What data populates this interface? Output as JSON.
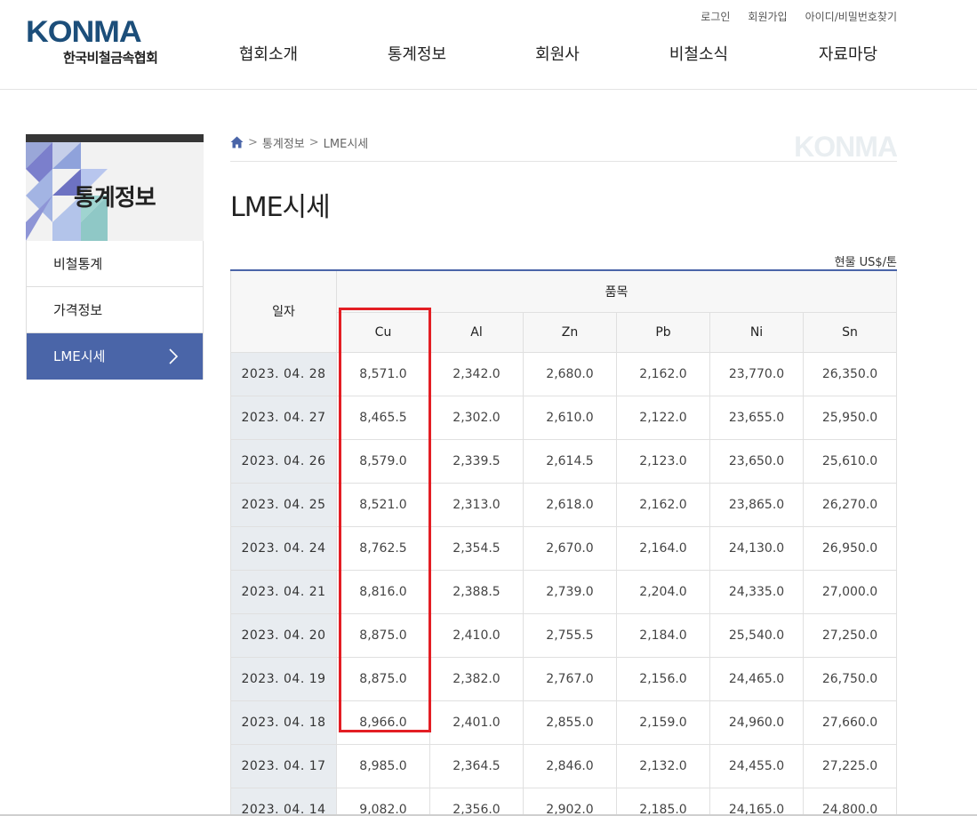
{
  "header": {
    "logo_text": "KONMA",
    "logo_sub": "한국비철금속협회",
    "util_links": [
      "로그인",
      "회원가입",
      "아이디/비밀번호찾기"
    ],
    "nav": [
      "협회소개",
      "통계정보",
      "회원사",
      "비철소식",
      "자료마당"
    ]
  },
  "sidebar": {
    "title": "통계정보",
    "items": [
      {
        "label": "비철통계",
        "active": false
      },
      {
        "label": "가격정보",
        "active": false
      },
      {
        "label": "LME시세",
        "active": true
      }
    ],
    "active_color": "#4a65a8"
  },
  "breadcrumb": {
    "items": [
      "통계정보",
      "LME시세"
    ],
    "ghost_logo": "KONMA"
  },
  "page": {
    "title": "LME시세",
    "unit": "현물 US$/톤"
  },
  "table": {
    "header_date": "일자",
    "header_group": "품목",
    "columns": [
      "Cu",
      "Al",
      "Zn",
      "Pb",
      "Ni",
      "Sn"
    ],
    "rows": [
      {
        "date": "2023. 04. 28",
        "values": [
          "8,571.0",
          "2,342.0",
          "2,680.0",
          "2,162.0",
          "23,770.0",
          "26,350.0"
        ]
      },
      {
        "date": "2023. 04. 27",
        "values": [
          "8,465.5",
          "2,302.0",
          "2,610.0",
          "2,122.0",
          "23,655.0",
          "25,950.0"
        ]
      },
      {
        "date": "2023. 04. 26",
        "values": [
          "8,579.0",
          "2,339.5",
          "2,614.5",
          "2,123.0",
          "23,650.0",
          "25,610.0"
        ]
      },
      {
        "date": "2023. 04. 25",
        "values": [
          "8,521.0",
          "2,313.0",
          "2,618.0",
          "2,162.0",
          "23,865.0",
          "26,270.0"
        ]
      },
      {
        "date": "2023. 04. 24",
        "values": [
          "8,762.5",
          "2,354.5",
          "2,670.0",
          "2,164.0",
          "24,130.0",
          "26,950.0"
        ]
      },
      {
        "date": "2023. 04. 21",
        "values": [
          "8,816.0",
          "2,388.5",
          "2,739.0",
          "2,204.0",
          "24,335.0",
          "27,000.0"
        ]
      },
      {
        "date": "2023. 04. 20",
        "values": [
          "8,875.0",
          "2,410.0",
          "2,755.5",
          "2,184.0",
          "25,540.0",
          "27,250.0"
        ]
      },
      {
        "date": "2023. 04. 19",
        "values": [
          "8,875.0",
          "2,382.0",
          "2,767.0",
          "2,156.0",
          "24,465.0",
          "26,750.0"
        ]
      },
      {
        "date": "2023. 04. 18",
        "values": [
          "8,966.0",
          "2,401.0",
          "2,855.0",
          "2,159.0",
          "24,960.0",
          "27,660.0"
        ]
      },
      {
        "date": "2023. 04. 17",
        "values": [
          "8,985.0",
          "2,364.5",
          "2,846.0",
          "2,132.0",
          "24,455.0",
          "27,225.0"
        ]
      },
      {
        "date": "2023. 04. 14",
        "values": [
          "9,082.0",
          "2,356.0",
          "2,902.0",
          "2,185.0",
          "24,165.0",
          "24,800.0"
        ]
      }
    ],
    "highlight_color": "#e31e24"
  }
}
